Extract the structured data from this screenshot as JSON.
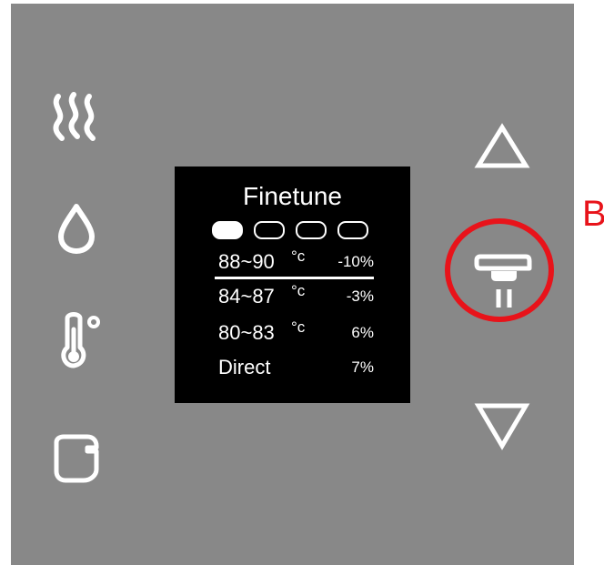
{
  "colors": {
    "panel_background": "#888888",
    "screen_background": "#000000",
    "screen_text": "#ffffff",
    "icon_color": "#ffffff",
    "annotation_color": "#e8131a"
  },
  "left_buttons": [
    {
      "icon": "steam-icon"
    },
    {
      "icon": "water-drop-icon"
    },
    {
      "icon": "thermometer-icon"
    },
    {
      "icon": "cup-icon"
    }
  ],
  "right_buttons": [
    {
      "icon": "up-arrow-icon"
    },
    {
      "icon": "dispense-icon"
    },
    {
      "icon": "down-arrow-icon"
    }
  ],
  "screen": {
    "title": "Finetune",
    "indicators": {
      "total": 4,
      "active": 1
    },
    "rows": [
      {
        "temp": "88~90",
        "unit": "°c",
        "percent": "-10%",
        "selected": true
      },
      {
        "temp": "84~87",
        "unit": "°c",
        "percent": "-3%",
        "selected": false
      },
      {
        "temp": "80~83",
        "unit": "°c",
        "percent": "6%",
        "selected": false
      },
      {
        "temp": "Direct",
        "unit": "",
        "percent": "7%",
        "selected": false
      }
    ]
  },
  "annotation": {
    "label": "B"
  }
}
